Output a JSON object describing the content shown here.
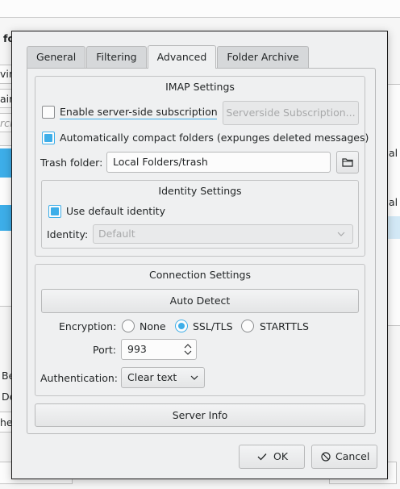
{
  "background": {
    "fragments": {
      "f1": "fo",
      "f2": "vin",
      "f3": "ain",
      "search": "rch",
      "rcol1": "al C",
      "rcol2": "al C",
      "b1": "Be",
      "b2": "De",
      "b3": "he"
    }
  },
  "dialog": {
    "tabs": [
      "General",
      "Filtering",
      "Advanced",
      "Folder Archive"
    ],
    "active_tab": "Advanced",
    "imap": {
      "title": "IMAP Settings",
      "enable_subscriptions_label": "Enable server-side subscriptions",
      "enable_subscriptions_checked": false,
      "serverside_button": "Serverside Subscription...",
      "compact_label": "Automatically compact folders (expunges deleted messages)",
      "compact_checked": true,
      "trash_label": "Trash folder:",
      "trash_value": "Local Folders/trash",
      "identity": {
        "title": "Identity Settings",
        "use_default_label": "Use default identity",
        "use_default_checked": true,
        "identity_label": "Identity:",
        "identity_value": "Default"
      }
    },
    "connection": {
      "title": "Connection Settings",
      "auto_detect": "Auto Detect",
      "encryption_label": "Encryption:",
      "encryption_options": [
        "None",
        "SSL/TLS",
        "STARTTLS"
      ],
      "encryption_selected": "SSL/TLS",
      "port_label": "Port:",
      "port_value": "993",
      "auth_label": "Authentication:",
      "auth_value": "Clear text"
    },
    "server_info": "Server Info",
    "ok": "OK",
    "cancel": "Cancel"
  },
  "colors": {
    "accent": "#3daee9",
    "dialog_bg": "#eff0f1"
  }
}
